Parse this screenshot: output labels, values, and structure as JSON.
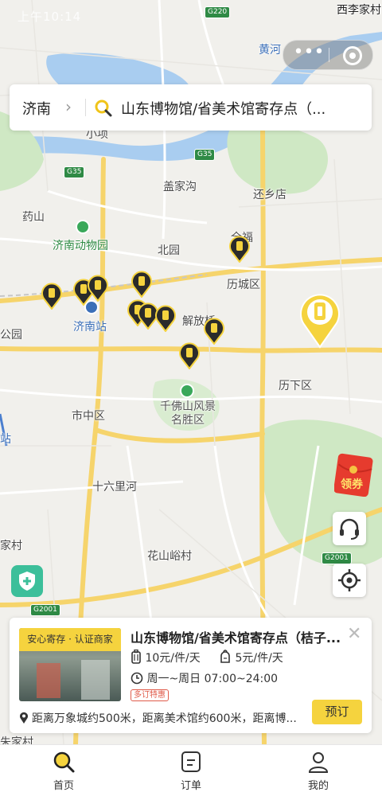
{
  "status_bar": {
    "time": "上午10:14"
  },
  "search": {
    "city": "济南",
    "query": "山东博物馆/省美术馆寄存点（..."
  },
  "map": {
    "labels": {
      "top_right": "西李家村",
      "huanghe": "黄河",
      "xiaoqing": "小项",
      "gaijiagou": "盖家沟",
      "huanxiangdian": "还乡店",
      "yaoshan": "药山",
      "zoo": "济南动物园",
      "beiyuan": "北园",
      "quanfu": "全福",
      "lichengqu": "历城区",
      "jiefangqiao": "解放桥",
      "station": "济南站",
      "park": "公园",
      "lixiaqu": "历下区",
      "shizhongqu": "市中区",
      "qianfoshan": "千佛山风景名胜区",
      "zhan": "站",
      "shiliulihe": "十六里河",
      "village_left": "家村",
      "huashanyu": "花山峪村",
      "zhujiacun": "朱家村"
    },
    "roads": [
      "G220",
      "G35",
      "G35",
      "G2001",
      "G2001"
    ]
  },
  "coupon": {
    "label": "领券"
  },
  "card": {
    "badge": "安心寄存 · 认证商家",
    "title": "山东博物馆/省美术馆寄存点（桔子...",
    "price_large": "10元/件/天",
    "price_small": "5元/件/天",
    "hours": "周一~周日 07:00~24:00",
    "promo": "多订特惠",
    "distance": "距离万象城约500米，距离美术馆约600米，距离博...",
    "book_label": "预订"
  },
  "tabs": [
    {
      "label": "首页"
    },
    {
      "label": "订单"
    },
    {
      "label": "我的"
    }
  ],
  "colors": {
    "accent": "#f5d33e",
    "pin_dark": "#2b2b2b",
    "river": "#a9cdf0",
    "green": "#cfe8c4"
  }
}
